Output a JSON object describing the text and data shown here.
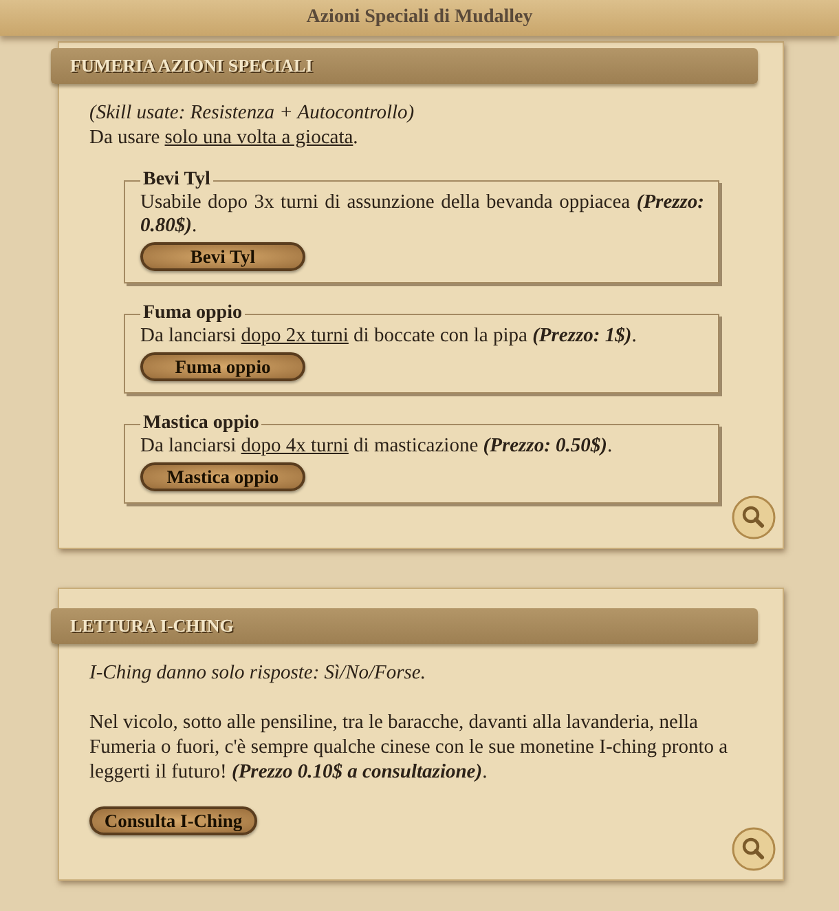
{
  "window": {
    "title": "Azioni Speciali di Mudalley"
  },
  "panels": [
    {
      "title": "FUMERIA AZIONI SPECIALI",
      "intro": [
        [
          {
            "kind": "italic",
            "text": "(Skill usate: Resistenza + Autocontrollo)"
          }
        ],
        [
          {
            "kind": "plain",
            "text": "Da usare "
          },
          {
            "kind": "link",
            "text": "solo una volta a giocata"
          },
          {
            "kind": "plain",
            "text": "."
          }
        ]
      ],
      "actions": [
        {
          "legend": "Bevi Tyl",
          "description": [
            {
              "kind": "plain",
              "text": "Usabile dopo 3x turni di assunzione della bevanda oppiacea "
            },
            {
              "kind": "price",
              "text": "(Prezzo: 0.80$)"
            },
            {
              "kind": "plain",
              "text": "."
            }
          ],
          "button": "Bevi Tyl"
        },
        {
          "legend": "Fuma oppio",
          "description": [
            {
              "kind": "plain",
              "text": "Da lanciarsi "
            },
            {
              "kind": "link",
              "text": "dopo 2x turni"
            },
            {
              "kind": "plain",
              "text": " di boccate con la pipa "
            },
            {
              "kind": "price",
              "text": "(Prezzo: 1$)"
            },
            {
              "kind": "plain",
              "text": "."
            }
          ],
          "button": "Fuma oppio"
        },
        {
          "legend": "Mastica oppio",
          "description": [
            {
              "kind": "plain",
              "text": "Da lanciarsi "
            },
            {
              "kind": "link",
              "text": "dopo 4x turni"
            },
            {
              "kind": "plain",
              "text": " di masticazione "
            },
            {
              "kind": "price",
              "text": "(Prezzo: 0.50$)"
            },
            {
              "kind": "plain",
              "text": "."
            }
          ],
          "button": "Mastica oppio"
        }
      ]
    },
    {
      "title": "LETTURA I-CHING",
      "intro": [
        [
          {
            "kind": "italic",
            "text": "I-Ching danno solo risposte: Sì/No/Forse."
          }
        ],
        [
          {
            "kind": "plain",
            "text": "Nel vicolo, sotto alle pensiline, tra le baracche, davanti alla lavanderia, nella Fumeria o fuori, c'è sempre qualche cinese con le sue monetine I-ching pronto a leggerti il futuro! "
          },
          {
            "kind": "price",
            "text": "(Prezzo 0.10$ a consultazione)"
          },
          {
            "kind": "plain",
            "text": "."
          }
        ]
      ],
      "button": "Consulta I-Ching"
    }
  ]
}
